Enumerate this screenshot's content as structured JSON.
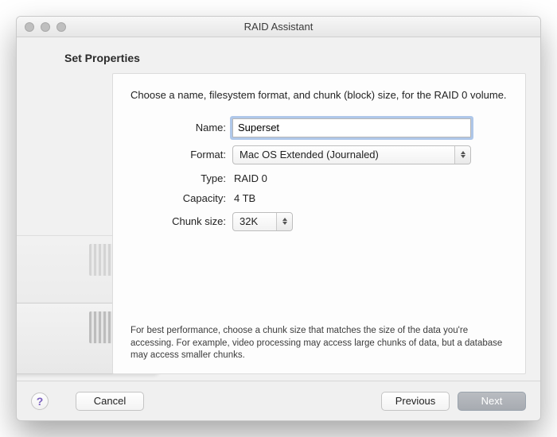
{
  "window": {
    "title": "RAID Assistant"
  },
  "heading": "Set Properties",
  "description": "Choose a name, filesystem format, and chunk (block) size, for the RAID 0 volume.",
  "fields": {
    "name": {
      "label": "Name:",
      "value": "Superset"
    },
    "format": {
      "label": "Format:",
      "value": "Mac OS Extended (Journaled)"
    },
    "type": {
      "label": "Type:",
      "value": "RAID 0"
    },
    "capacity": {
      "label": "Capacity:",
      "value": "4 TB"
    },
    "chunk": {
      "label": "Chunk size:",
      "value": "32K"
    }
  },
  "footnote": "For best performance, choose a chunk size that matches the size of the data you're accessing. For example, video processing may access large chunks of data, but a database may access smaller chunks.",
  "buttons": {
    "help": "?",
    "cancel": "Cancel",
    "previous": "Previous",
    "next": "Next"
  }
}
